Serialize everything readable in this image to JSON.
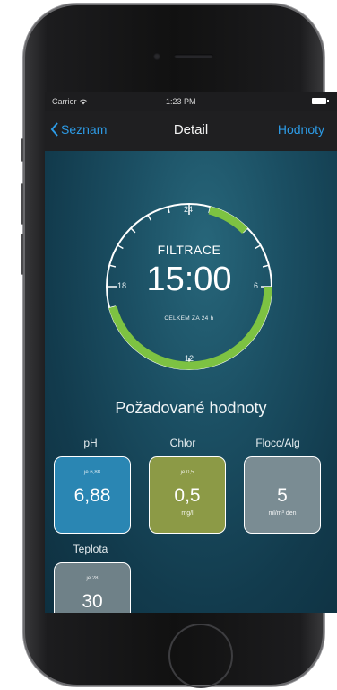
{
  "status": {
    "carrier": "Carrier",
    "time": "1:23 PM"
  },
  "nav": {
    "back_label": "Seznam",
    "title": "Detail",
    "right_label": "Hodnoty"
  },
  "dial": {
    "label": "FILTRACE",
    "time": "15:00",
    "subtitle": "CELKEM ZA 24 h",
    "hours": {
      "top": "24",
      "right": "6",
      "bottom": "12",
      "left": "18"
    },
    "active_color": "#7dc242"
  },
  "section_title": "Požadované hodnoty",
  "params": [
    {
      "label": "pH",
      "current": "je 6,88",
      "value": "6,88",
      "unit": "",
      "color": "#2a86b3"
    },
    {
      "label": "Chlor",
      "current": "je 0,5",
      "value": "0,5",
      "unit": "mg/l",
      "color": "#8c9a46"
    },
    {
      "label": "Flocc/Alg",
      "current": "",
      "value": "5",
      "unit": "ml/m³ den",
      "color": "#7a8c93"
    },
    {
      "label": "Teplota",
      "current": "je 28",
      "value": "30",
      "unit": "",
      "color": "#6f8188"
    }
  ]
}
